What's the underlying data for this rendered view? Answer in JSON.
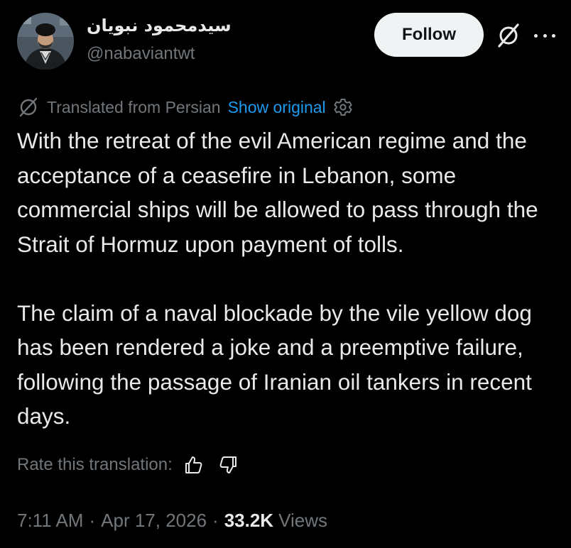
{
  "author": {
    "display_name": "سیدمحمود نبویان",
    "handle": "@nabaviantwt"
  },
  "header": {
    "follow_label": "Follow",
    "grok_icon": "grok-icon",
    "more_icon": "more-dots-icon"
  },
  "translation": {
    "label": "Translated from Persian",
    "show_original": "Show original",
    "globe_icon": "translate-globe-icon",
    "settings_icon": "gear-icon"
  },
  "tweet": {
    "paragraphs": [
      "With the retreat of the evil American regime and the acceptance of a ceasefire in Lebanon, some commercial ships will be allowed to pass through the Strait of Hormuz upon payment of tolls.",
      "The claim of a naval blockade by the vile yellow dog has been rendered a joke and a preemptive failure, following the passage of Iranian oil tankers in recent days."
    ]
  },
  "rating": {
    "label": "Rate this translation:",
    "thumbs_up_icon": "thumbs-up-icon",
    "thumbs_down_icon": "thumbs-down-icon"
  },
  "meta": {
    "time": "7:11 AM",
    "separator": "·",
    "date": "Apr 17, 2026",
    "views_count": "33.2K",
    "views_label": "Views"
  },
  "colors": {
    "background": "#000000",
    "text_primary": "#e7e9ea",
    "text_secondary": "#71767b",
    "link": "#1d9bf0",
    "follow_bg": "#eff3f4"
  }
}
